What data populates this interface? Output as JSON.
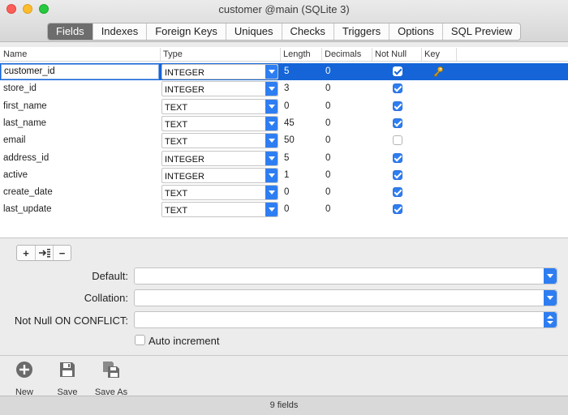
{
  "window": {
    "title": "customer @main (SQLite 3)"
  },
  "tabs": [
    {
      "label": "Fields",
      "active": true
    },
    {
      "label": "Indexes",
      "active": false
    },
    {
      "label": "Foreign Keys",
      "active": false
    },
    {
      "label": "Uniques",
      "active": false
    },
    {
      "label": "Checks",
      "active": false
    },
    {
      "label": "Triggers",
      "active": false
    },
    {
      "label": "Options",
      "active": false
    },
    {
      "label": "SQL Preview",
      "active": false
    }
  ],
  "grid": {
    "columns": {
      "name": "Name",
      "type": "Type",
      "length": "Length",
      "decimals": "Decimals",
      "not_null": "Not Null",
      "key": "Key"
    },
    "rows": [
      {
        "name": "customer_id",
        "type": "INTEGER",
        "length": "5",
        "decimals": "0",
        "not_null": true,
        "key": true,
        "selected": true
      },
      {
        "name": "store_id",
        "type": "INTEGER",
        "length": "3",
        "decimals": "0",
        "not_null": true,
        "key": false
      },
      {
        "name": "first_name",
        "type": "TEXT",
        "length": "0",
        "decimals": "0",
        "not_null": true,
        "key": false
      },
      {
        "name": "last_name",
        "type": "TEXT",
        "length": "45",
        "decimals": "0",
        "not_null": true,
        "key": false
      },
      {
        "name": "email",
        "type": "TEXT",
        "length": "50",
        "decimals": "0",
        "not_null": false,
        "key": false
      },
      {
        "name": "address_id",
        "type": "INTEGER",
        "length": "5",
        "decimals": "0",
        "not_null": true,
        "key": false
      },
      {
        "name": "active",
        "type": "INTEGER",
        "length": "1",
        "decimals": "0",
        "not_null": true,
        "key": false
      },
      {
        "name": "create_date",
        "type": "TEXT",
        "length": "0",
        "decimals": "0",
        "not_null": true,
        "key": false
      },
      {
        "name": "last_update",
        "type": "TEXT",
        "length": "0",
        "decimals": "0",
        "not_null": true,
        "key": false
      }
    ]
  },
  "field_buttons": {
    "add": "+",
    "insert": "→",
    "remove": "−"
  },
  "props": {
    "default_label": "Default:",
    "default_value": "",
    "collation_label": "Collation:",
    "collation_value": "",
    "conflict_label": "Not Null ON CONFLICT:",
    "conflict_value": "",
    "auto_increment_label": "Auto increment",
    "auto_increment_checked": false
  },
  "toolbar": {
    "new_label": "New",
    "save_label": "Save",
    "save_as_label": "Save As"
  },
  "status": {
    "text": "9 fields"
  },
  "colors": {
    "accent": "#2e7ef2",
    "selection": "#1565d8"
  }
}
